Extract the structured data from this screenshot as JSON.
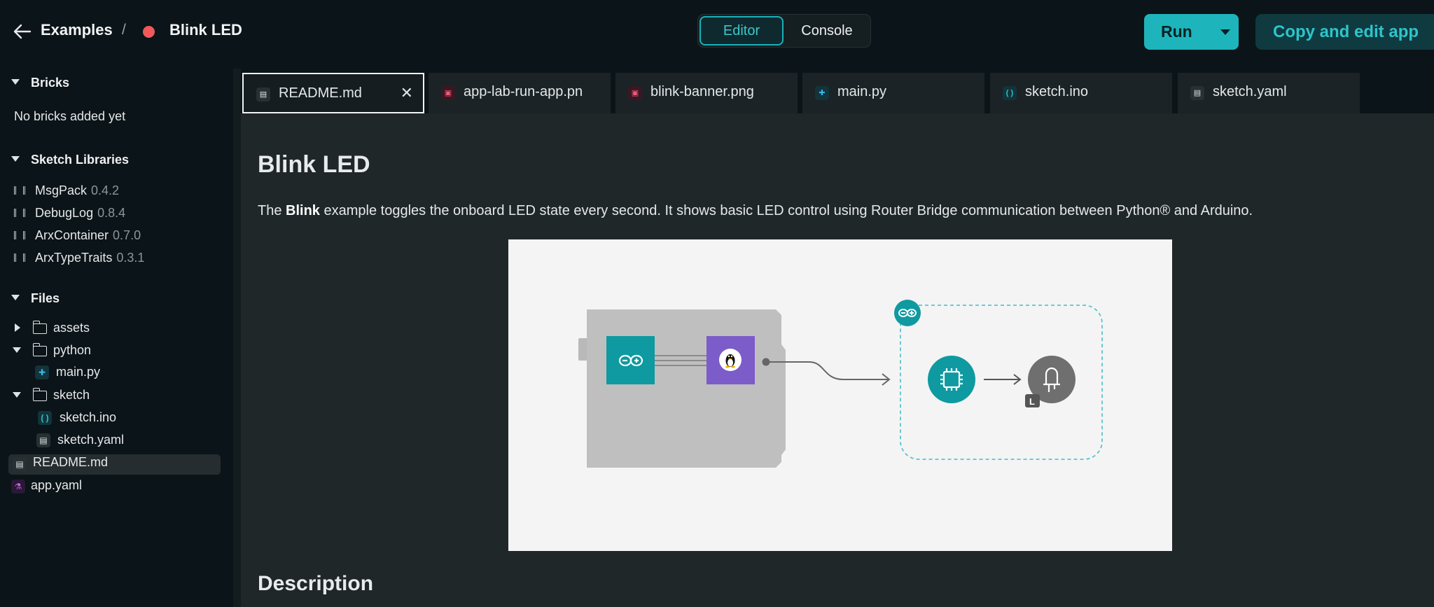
{
  "header": {
    "back_label": "Back",
    "breadcrumb_root": "Examples",
    "breadcrumb_sep": "/",
    "app_name": "Blink LED",
    "app_dot_color": "#f0585a",
    "view_tabs": {
      "editor": "Editor",
      "console": "Console"
    },
    "run_label": "Run",
    "copy_label": "Copy and edit app"
  },
  "sidebar": {
    "bricks": {
      "title": "Bricks",
      "empty": "No bricks added yet"
    },
    "libraries": {
      "title": "Sketch Libraries",
      "items": [
        {
          "name": "MsgPack",
          "version": "0.4.2"
        },
        {
          "name": "DebugLog",
          "version": "0.8.4"
        },
        {
          "name": "ArxContainer",
          "version": "0.7.0"
        },
        {
          "name": "ArxTypeTraits",
          "version": "0.3.1"
        }
      ]
    },
    "files": {
      "title": "Files",
      "tree": {
        "assets": "assets",
        "python": "python",
        "main_py": "main.py",
        "sketch": "sketch",
        "sketch_ino": "sketch.ino",
        "sketch_yaml": "sketch.yaml",
        "readme": "README.md",
        "app_yaml": "app.yaml"
      }
    }
  },
  "tabs": [
    {
      "label": "README.md",
      "icon": "doc-icon"
    },
    {
      "label": "app-lab-run-app.pn",
      "icon": "image-icon"
    },
    {
      "label": "blink-banner.png",
      "icon": "image-icon"
    },
    {
      "label": "main.py",
      "icon": "python-icon"
    },
    {
      "label": "sketch.ino",
      "icon": "arduino-file-icon"
    },
    {
      "label": "sketch.yaml",
      "icon": "doc-icon"
    }
  ],
  "readme": {
    "title": "Blink LED",
    "para_start": "The ",
    "para_bold": "Blink",
    "para_rest": " example toggles the onboard LED state every second. It shows basic LED control using Router Bridge communication between Python® and Arduino.",
    "badge_letter": "L",
    "section_heading": "Description"
  },
  "colors": {
    "accent": "#1db5bb",
    "background": "#0b1418",
    "panel": "#1f2729",
    "python_chip": "#7b5cc9",
    "mcu_chip": "#0e9aa0"
  }
}
